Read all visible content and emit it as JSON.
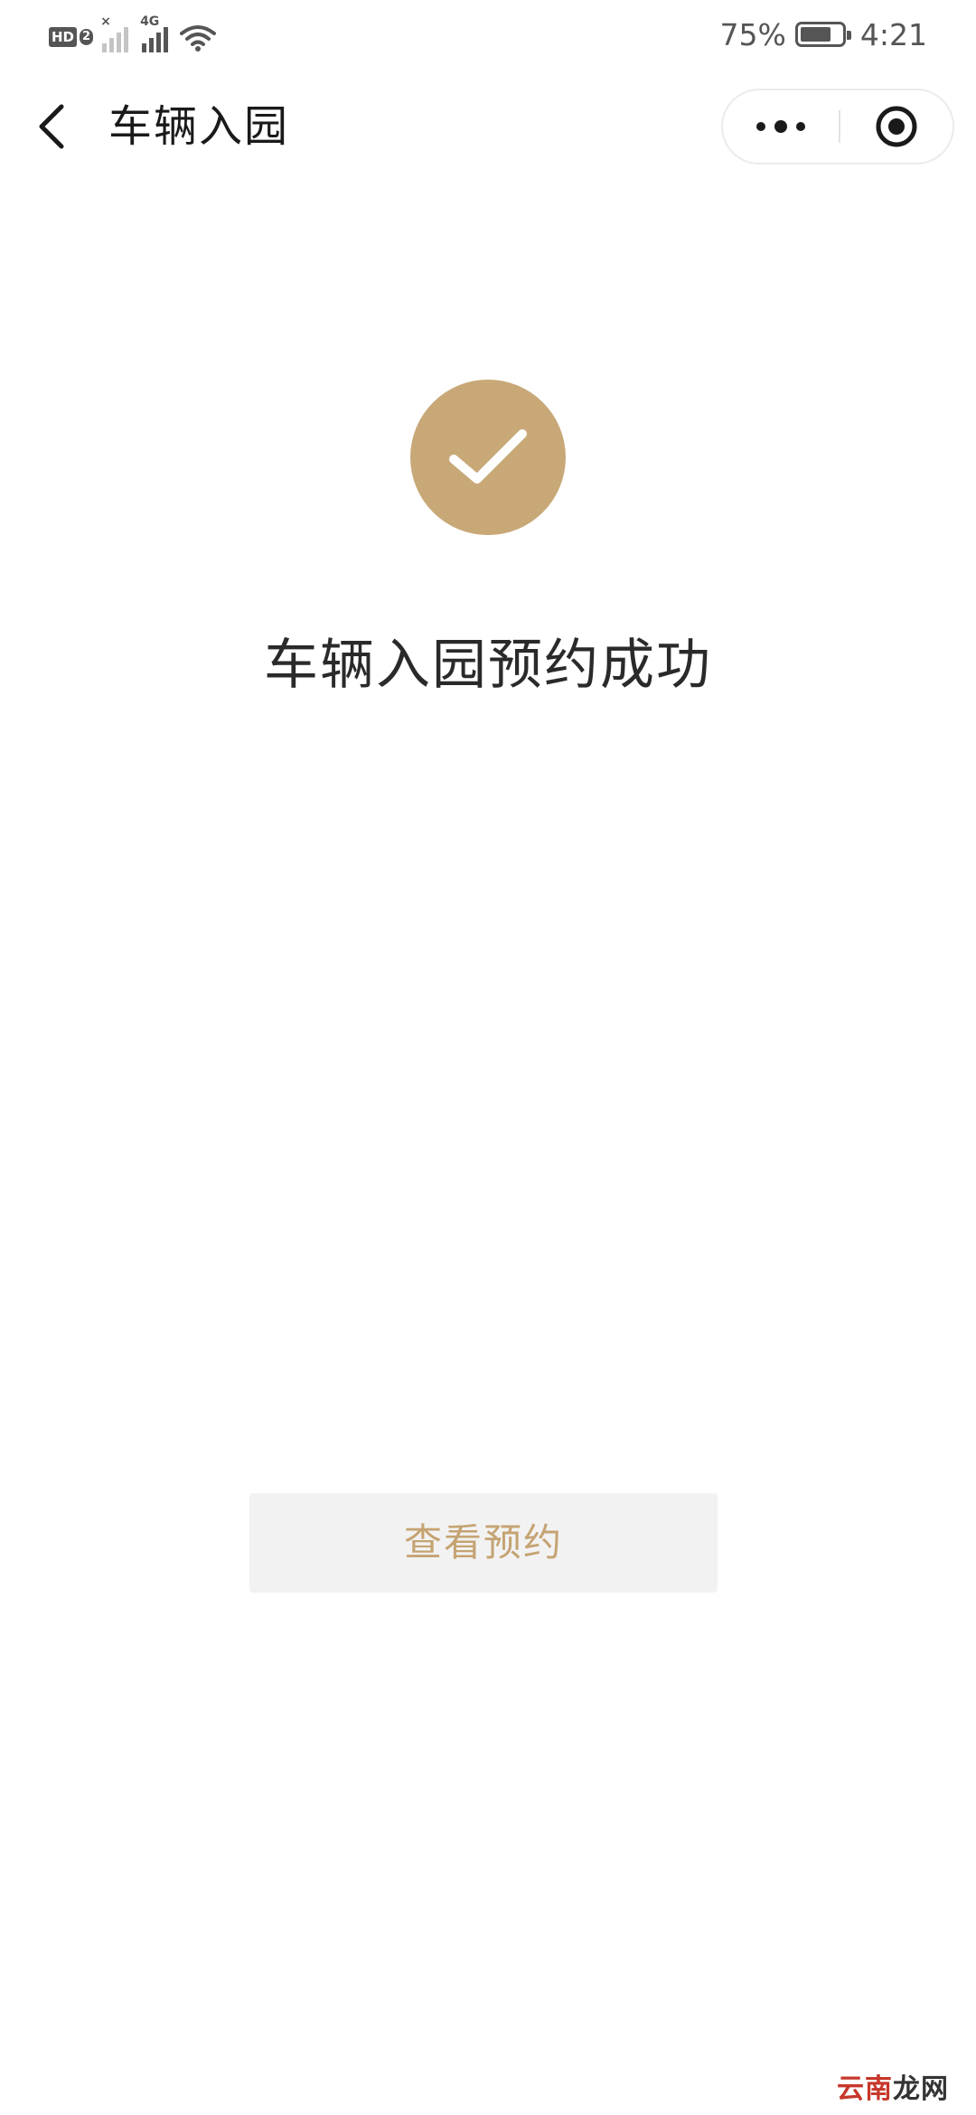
{
  "status_bar": {
    "hd_label": "HD",
    "sim_slot": "2",
    "network_type": "4G",
    "battery_percent": "75%",
    "battery_level": 0.75,
    "time": "4:21",
    "icons": [
      "hd-icon",
      "no-signal-icon",
      "signal-icon",
      "wifi-icon",
      "battery-icon"
    ]
  },
  "nav": {
    "title": "车辆入园",
    "back_icon": "chevron-left-icon",
    "more_icon": "more-dots-icon",
    "close_icon": "target-circle-icon"
  },
  "result": {
    "title": "车辆入园预约成功",
    "icon": "checkmark-icon",
    "icon_color": "#c9a878"
  },
  "actions": {
    "view_reservation_label": "查看预约",
    "button_text_color": "#c5a372",
    "button_bg_color": "#f2f2f2"
  },
  "watermark": {
    "accent": "云南",
    "rest": "龙网"
  }
}
